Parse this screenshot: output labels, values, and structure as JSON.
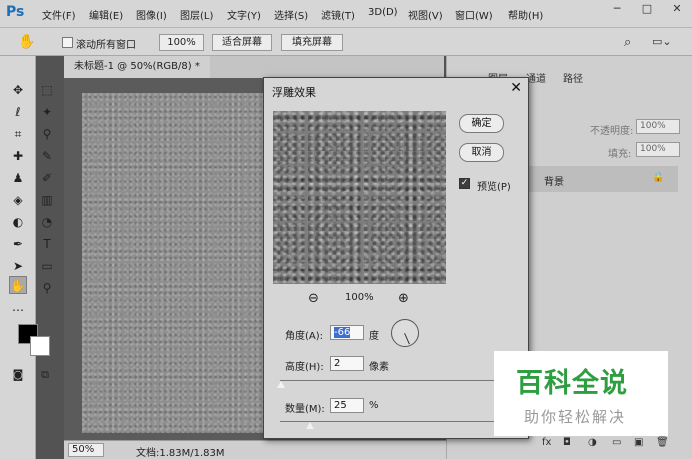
{
  "app": {
    "logo": "Ps",
    "accent": "#1d6fb8",
    "menu": [
      "文件(F)",
      "编辑(E)",
      "图像(I)",
      "图层(L)",
      "文字(Y)",
      "选择(S)",
      "滤镜(T)",
      "3D(D)",
      "视图(V)",
      "窗口(W)",
      "帮助(H)"
    ],
    "window_controls": {
      "minimize": "─",
      "maximize": "□",
      "close": "✕"
    }
  },
  "options_bar": {
    "scroll_all": "滚动所有窗口",
    "zoom_100": "100%",
    "fit_screen": "适合屏幕",
    "fill_screen": "填充屏幕"
  },
  "document": {
    "tab_title": "未标题-1 @ 50%(RGB/8) *",
    "zoom": "50%",
    "info": "文档:1.83M/1.83M"
  },
  "panels": {
    "tabs": [
      "图层",
      "通道",
      "路径"
    ],
    "opacity_label": "不透明度:",
    "opacity_value": "100%",
    "fill_label": "填充:",
    "fill_value": "100%",
    "layer_name": "背景"
  },
  "dialog": {
    "title": "浮雕效果",
    "close": "✕",
    "ok": "确定",
    "cancel": "取消",
    "preview_label": "预览(P)",
    "preview_checked": true,
    "preview_zoom": "100%",
    "angle_label": "角度(A):",
    "angle_value": "-66",
    "angle_unit": "度",
    "height_label": "高度(H):",
    "height_value": "2",
    "height_unit": "像素",
    "amount_label": "数量(M):",
    "amount_value": "25",
    "amount_unit": "%"
  },
  "watermark": {
    "main": "百科全说",
    "sub": "助你轻松解决",
    "color": "#2e9e41"
  }
}
